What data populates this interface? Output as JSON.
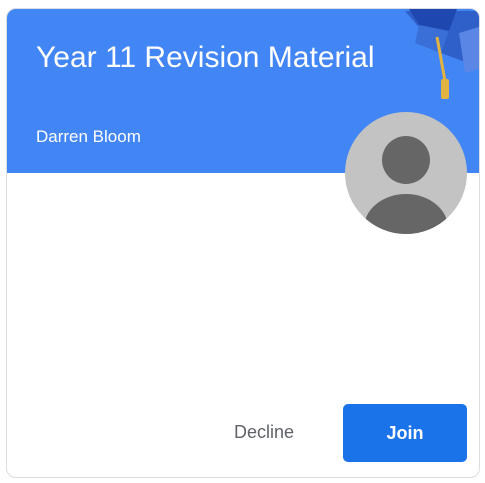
{
  "class_card": {
    "title": "Year 11 Revision Material",
    "teacher": "Darren Bloom",
    "banner_color": "#4285f4",
    "avatar_icon": "default-user-avatar",
    "banner_decoration_icon": "graduation-cap-icon"
  },
  "actions": {
    "decline_label": "Decline",
    "join_label": "Join",
    "join_color": "#1a73e8"
  }
}
